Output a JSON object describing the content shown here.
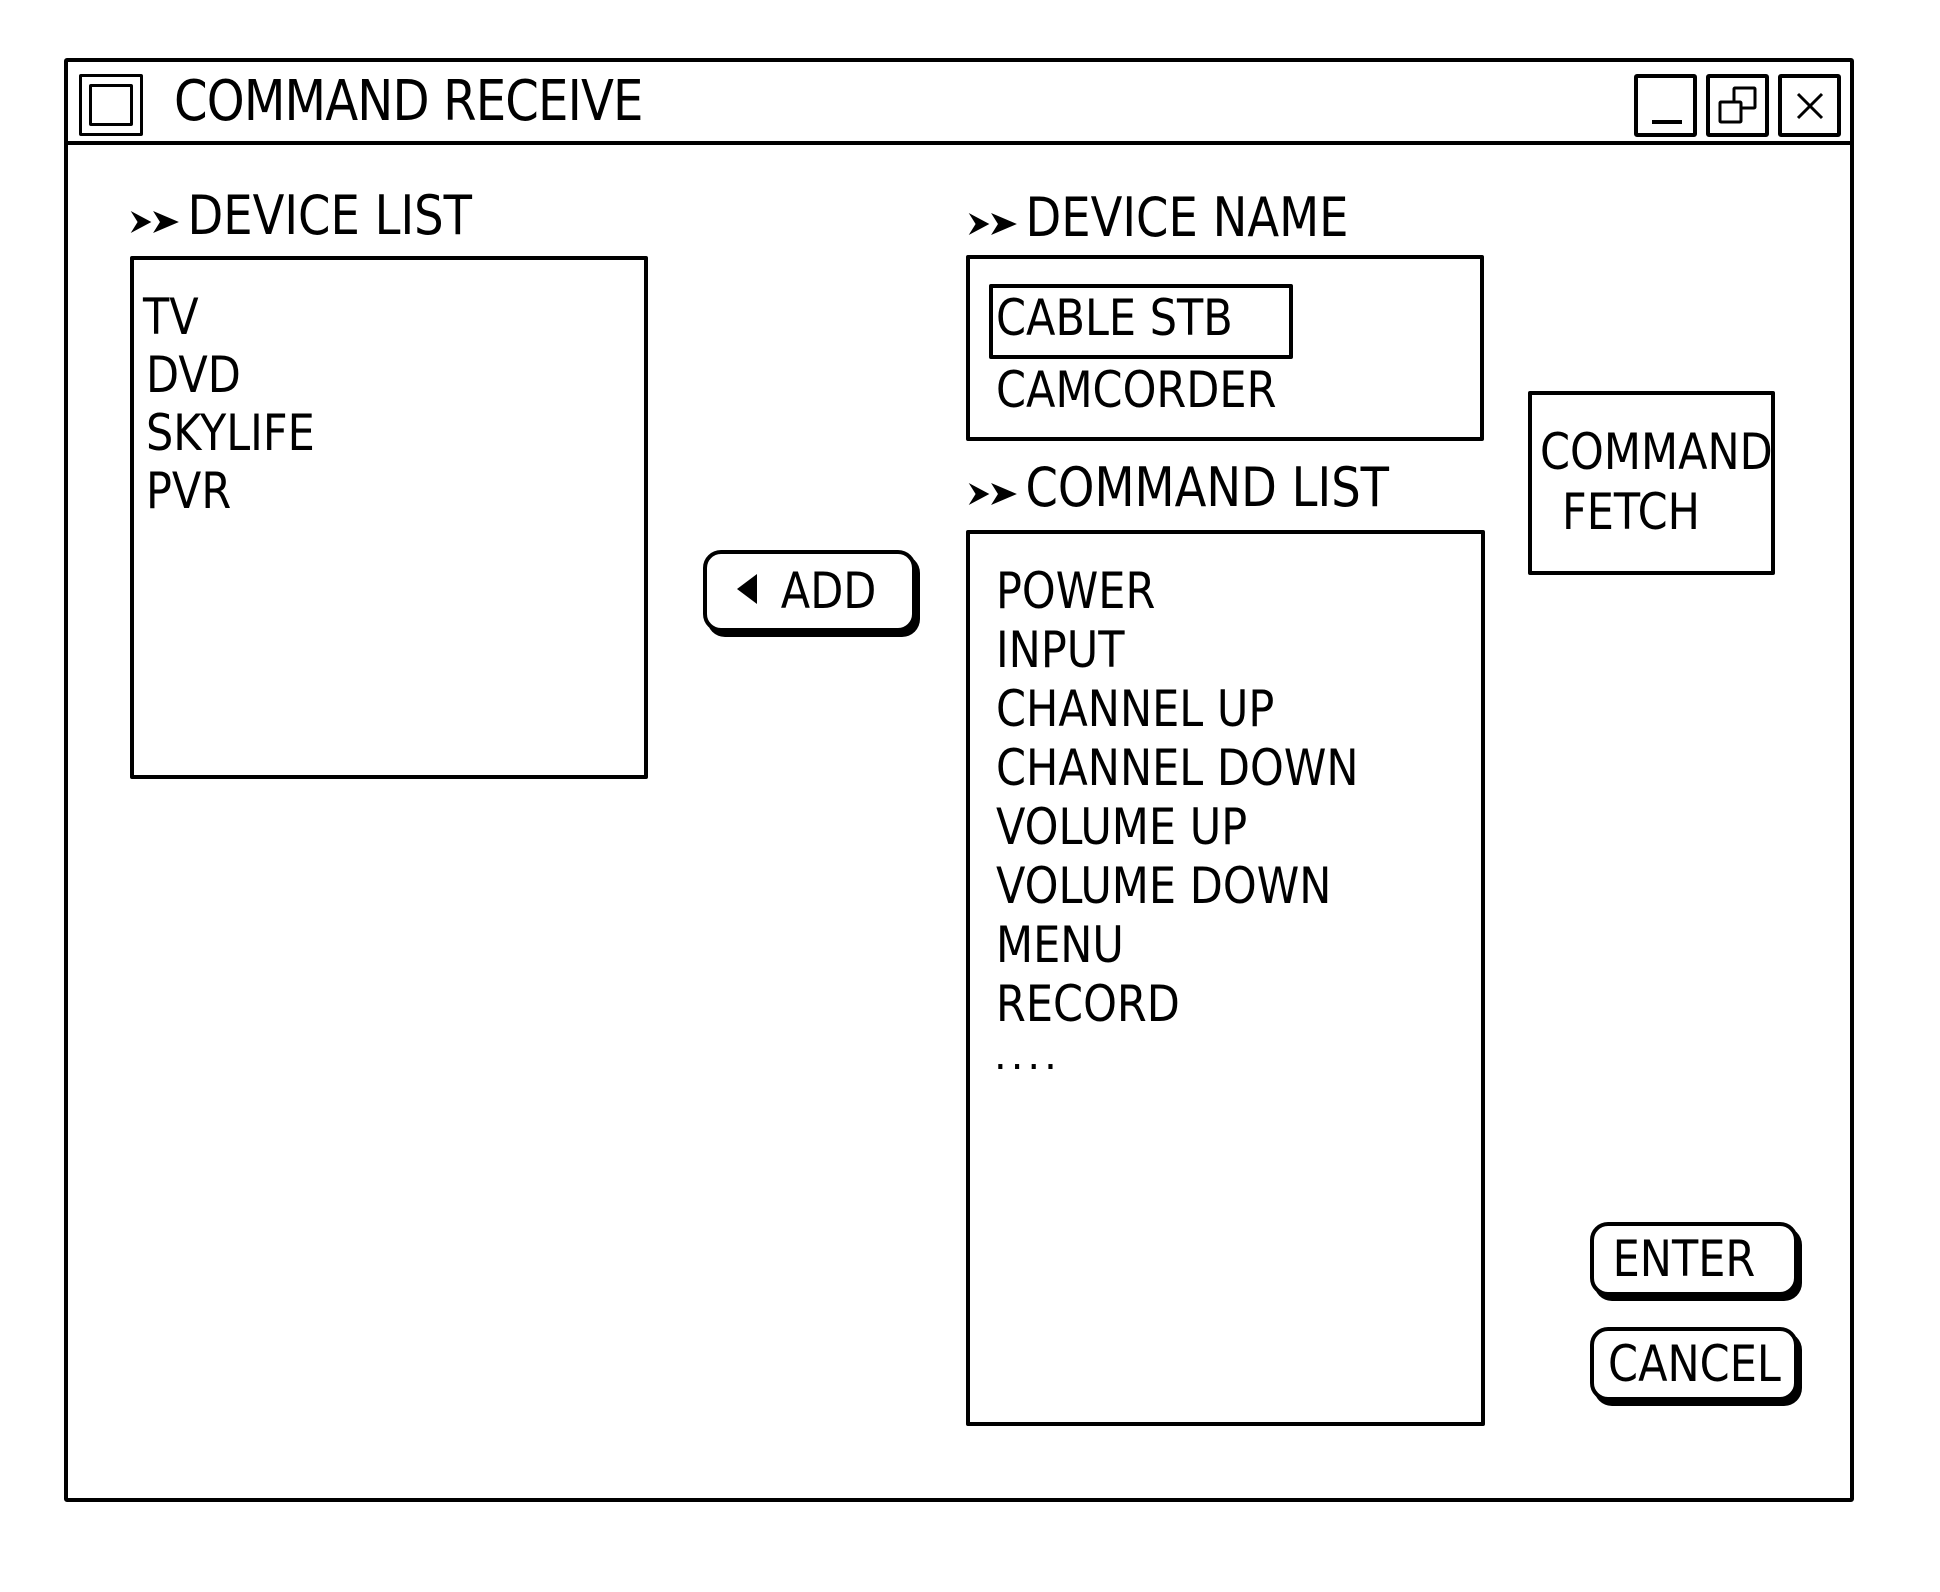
{
  "window": {
    "title": "COMMAND RECEIVE",
    "controls": {
      "minimize": "minimize-icon",
      "restore": "restore-icon",
      "close": "close-icon"
    }
  },
  "device_list": {
    "heading": "DEVICE LIST",
    "heading_icon": "double-chevron-right-icon",
    "items": [
      "TV",
      "DVD",
      "SKYLIFE",
      "PVR"
    ]
  },
  "add_button": {
    "label": "ADD",
    "icon": "triangle-left-icon"
  },
  "device_name": {
    "heading": "DEVICE NAME",
    "heading_icon": "double-chevron-right-icon",
    "items": [
      "CABLE STB",
      "CAMCORDER"
    ],
    "selected": "CABLE STB"
  },
  "command_list": {
    "heading": "COMMAND LIST",
    "heading_icon": "double-chevron-right-icon",
    "items": [
      "POWER",
      "INPUT",
      "CHANNEL UP",
      "CHANNEL DOWN",
      "VOLUME UP",
      "VOLUME DOWN",
      "MENU",
      "RECORD"
    ],
    "more_indicator": "...."
  },
  "command_fetch_button": {
    "line1": "COMMAND",
    "line2": "FETCH"
  },
  "footer_buttons": {
    "enter": "ENTER",
    "cancel": "CANCEL"
  }
}
